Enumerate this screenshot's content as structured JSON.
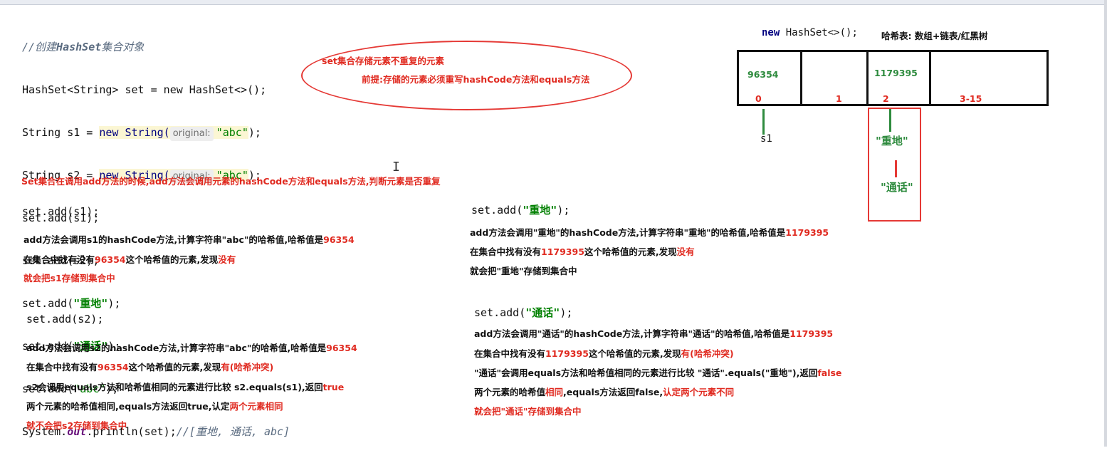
{
  "code": {
    "comment_prefix": "//创建",
    "comment_class": "HashSet",
    "comment_suffix": "集合对象",
    "line1": "HashSet<String> set = new HashSet<>();",
    "line2_a": "String s1 = ",
    "line2_b": "new String(",
    "hint": "original:",
    "line2_c": "\"abc\"",
    "line2_d": ");",
    "line3_a": "String s2 = ",
    "line4": "set.add(s1);",
    "line5": "set.add(s2);",
    "line6_a": "set.add(",
    "line6_s": "\"重地\"",
    "line6_b": ");",
    "line7_s": "\"通话\"",
    "line8_s": "\"abc\"",
    "line9_a": "System.",
    "line9_out": "out",
    "line9_b": ".println(set);",
    "line9_c": "//[重地, 通话, abc]"
  },
  "ellipse": {
    "line1": "set集合存储元素不重复的元素",
    "line2": "前提:存储的元素必须重写hashCode方法和equals方法"
  },
  "diagram": {
    "title_code": "new HashSet<>();",
    "title_text": "哈希表: 数组+链表/红黑树",
    "cell_values": [
      "96354",
      "",
      "1179395",
      ""
    ],
    "indices": [
      "0",
      "1",
      "2",
      "3-15"
    ],
    "chain_s1": "s1",
    "chain_a": "\"重地\"",
    "chain_b": "\"通话\""
  },
  "heading": "Set集合在调用add方法的时候,add方法会调用元素的hashCode方法和equals方法,判断元素是否重复",
  "block_s1": {
    "code": "set.add(s1);",
    "l1_a": "add方法会调用s1的hashCode方法,计算字符串\"abc\"的哈希值,哈希值是",
    "l1_b": "96354",
    "l2_a": "在集合中找有没有",
    "l2_b": "96354",
    "l2_c": "这个哈希值的元素,发现",
    "l2_d": "没有",
    "l3": "就会把s1存储到集合中"
  },
  "block_s2": {
    "code": "set.add(s2);",
    "l1_a": "add方法会调用s2的hashCode方法,计算字符串\"abc\"的哈希值,哈希值是",
    "l1_b": "96354",
    "l2_a": "在集合中找有没有",
    "l2_b": "96354",
    "l2_c": "这个哈希值的元素,发现",
    "l2_d": "有(哈希冲突)",
    "l3_a": "s2会调用equals方法和哈希值相同的元素进行比较 s2.equals(s1),返回",
    "l3_b": "true",
    "l4_a": "两个元素的哈希值相同,equals方法返回true,认定",
    "l4_b": "两个元素相同",
    "l5": "就不会把s2存储到集合中"
  },
  "block_zd": {
    "code_a": "set.add(",
    "code_s": "\"重地\"",
    "code_b": ");",
    "l1_a": "add方法会调用\"重地\"的hashCode方法,计算字符串\"重地\"的哈希值,哈希值是",
    "l1_b": "1179395",
    "l2_a": "在集合中找有没有",
    "l2_b": "1179395",
    "l2_c": "这个哈希值的元素,发现",
    "l2_d": "没有",
    "l3": "就会把\"重地\"存储到集合中"
  },
  "block_th": {
    "code_a": "set.add(",
    "code_s": "\"通话\"",
    "code_b": ");",
    "l1_a": "add方法会调用\"通话\"的hashCode方法,计算字符串\"通话\"的哈希值,哈希值是",
    "l1_b": "1179395",
    "l2_a": "在集合中找有没有",
    "l2_b": "1179395",
    "l2_c": "这个哈希值的元素,发现",
    "l2_d": "有(哈希冲突)",
    "l3_a": "\"通话\"会调用equals方法和哈希值相同的元素进行比较 \"通话\".equals(\"重地\"),返回",
    "l3_b": "false",
    "l4_a": "两个元素的哈希值",
    "l4_b": "相同",
    "l4_c": ",equals方法返回false,",
    "l4_d": "认定两个元素不同",
    "l5": "就会把\"通话\"存储到集合中"
  },
  "colors": {
    "red": "#e02a20",
    "green": "#2e8b3e",
    "keyword": "#000080"
  },
  "cursor_glyph": "I"
}
